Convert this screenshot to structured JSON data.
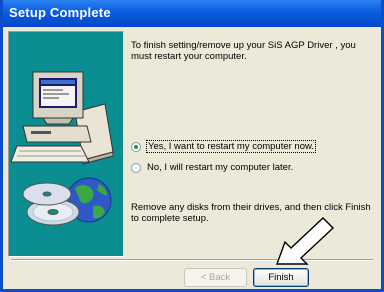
{
  "window": {
    "title": "Setup Complete"
  },
  "message": "To finish setting/remove up your SiS AGP Driver , you must restart your computer.",
  "options": [
    {
      "label": "Yes, I want to restart my computer now.",
      "checked": true
    },
    {
      "label": "No, I will restart my computer later.",
      "checked": false
    }
  ],
  "note": "Remove any disks from their drives, and then click Finish to complete setup.",
  "buttons": {
    "back": "< Back",
    "finish": "Finish"
  },
  "colors": {
    "titlebar": "#0b5ce0",
    "panel": "#0b8e91",
    "dialog": "#ece9d8"
  }
}
